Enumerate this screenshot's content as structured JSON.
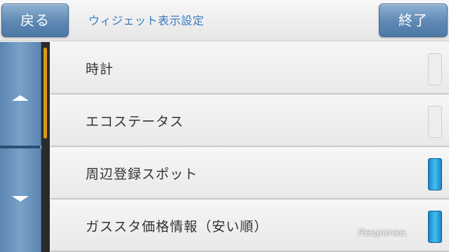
{
  "header": {
    "back_label": "戻る",
    "title": "ウィジェット表示設定",
    "exit_label": "終了"
  },
  "scroll": {
    "up_icon": "chevron-up-icon",
    "down_icon": "chevron-down-icon",
    "position_fraction": 0.03
  },
  "list": {
    "items": [
      {
        "label": "時計",
        "checked": false
      },
      {
        "label": "エコステータス",
        "checked": false
      },
      {
        "label": "周辺登録スポット",
        "checked": true
      },
      {
        "label": "ガススタ価格情報（安い順）",
        "checked": true
      }
    ]
  },
  "watermark": {
    "text": "Response."
  },
  "colors": {
    "accent": "#5e88b3",
    "title_text": "#3a7ac0",
    "check_on": "#2aa6e0",
    "scroll_thumb": "#d99a1a"
  }
}
